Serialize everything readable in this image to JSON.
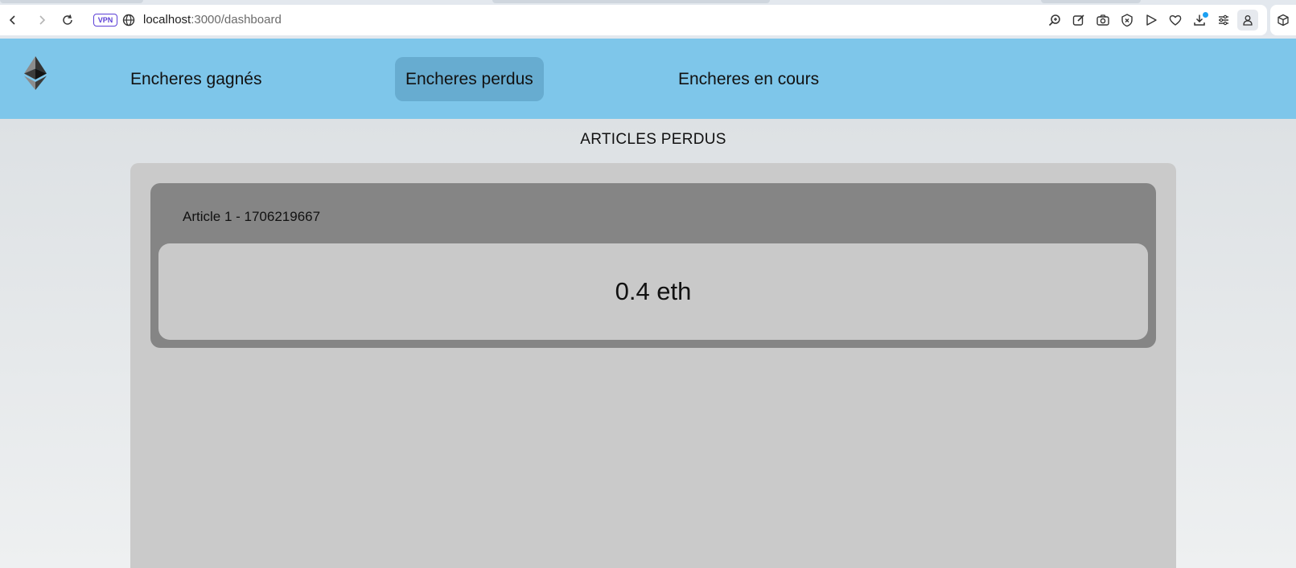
{
  "browser": {
    "url_host": "localhost",
    "url_rest": ":3000/dashboard",
    "vpn_label": "VPN",
    "icons": [
      "back-icon",
      "forward-icon",
      "reload-icon",
      "globe-icon",
      "zoom-icon",
      "edit-icon",
      "camera-icon",
      "shield-x-icon",
      "send-icon",
      "heart-icon",
      "download-icon",
      "sliders-icon",
      "profile-icon",
      "extension-cube-icon"
    ]
  },
  "nav": {
    "logo": "ethereum-logo-icon",
    "links": [
      {
        "label": "Encheres gagnés",
        "active": false
      },
      {
        "label": "Encheres perdus",
        "active": true
      },
      {
        "label": "Encheres en cours",
        "active": false
      }
    ]
  },
  "main": {
    "heading": "ARTICLES PERDUS",
    "articles": [
      {
        "title": "Article 1 - 1706219667",
        "price": "0.4 eth"
      }
    ]
  },
  "colors": {
    "nav_bg": "#7ec6ea",
    "nav_active": "#67acd0",
    "panel_bg": "#cacaca",
    "card_bg": "#858585",
    "price_bg": "#c9c9c9",
    "vpn_accent": "#5b3fd6"
  }
}
